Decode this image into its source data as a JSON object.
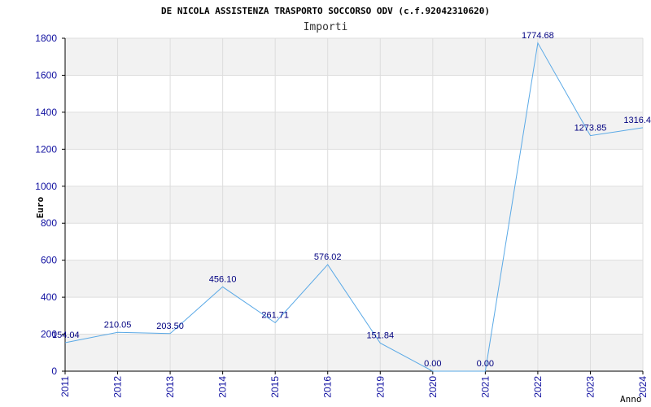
{
  "chart_data": {
    "type": "line",
    "title": "DE NICOLA ASSISTENZA TRASPORTO SOCCORSO ODV (c.f.92042310620)",
    "subtitle": "Importi",
    "xlabel": "Anno",
    "ylabel": "Euro",
    "ylim": [
      0,
      1800
    ],
    "yticks": [
      0,
      200,
      400,
      600,
      800,
      1000,
      1200,
      1400,
      1600,
      1800
    ],
    "grid": true,
    "legend": "none",
    "x": [
      "2011",
      "2012",
      "2013",
      "2014",
      "2015",
      "2016",
      "2019",
      "2020",
      "2021",
      "2022",
      "2023",
      "2024"
    ],
    "values": [
      154.04,
      210.05,
      203.5,
      456.1,
      261.71,
      576.02,
      151.84,
      0.0,
      0.0,
      1774.68,
      1273.85,
      1316.4
    ],
    "data_labels": [
      "154.04",
      "210.05",
      "203.50",
      "456.10",
      "261.71",
      "576.02",
      "151.84",
      "0.00",
      "0.00",
      "1774.68",
      "1273.85",
      "1316.4"
    ],
    "colors": {
      "line": "#5aa9e6",
      "band": "#f2f2f2",
      "grid": "#dddddd",
      "tick_text": "#1010a0",
      "label_text": "#000080"
    }
  }
}
